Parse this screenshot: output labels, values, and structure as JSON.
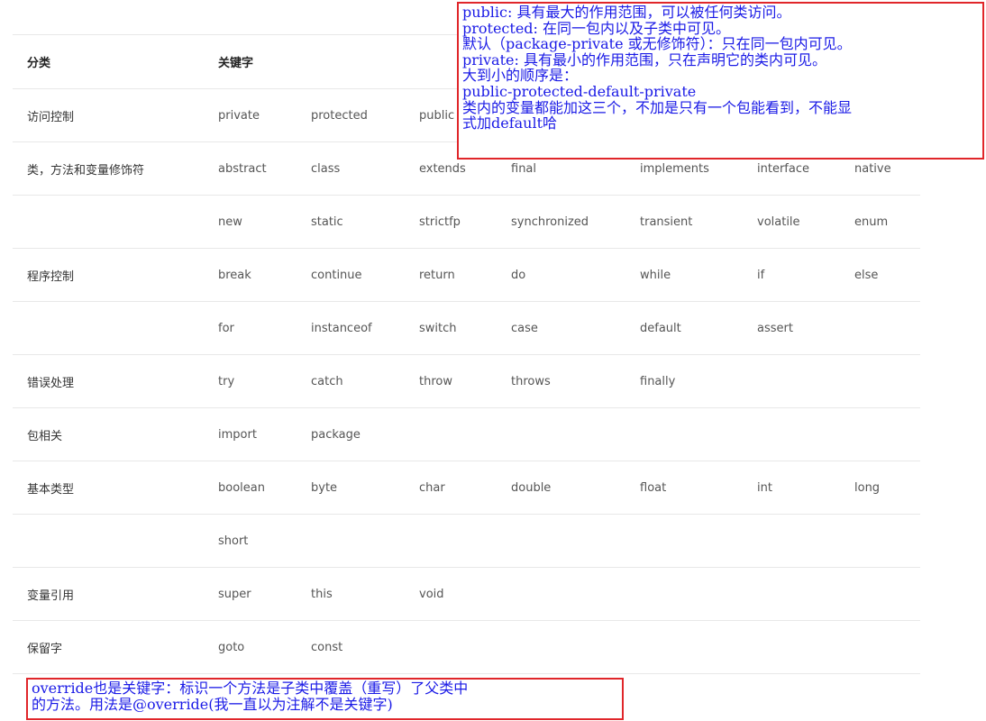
{
  "table": {
    "headers": [
      "分类",
      "关键字",
      "",
      "",
      "",
      "",
      "",
      ""
    ],
    "rows": [
      [
        "访问控制",
        "private",
        "protected",
        "public",
        "",
        "",
        "",
        ""
      ],
      [
        "类，方法和变量修饰符",
        "abstract",
        "class",
        "extends",
        "final",
        "implements",
        "interface",
        "native"
      ],
      [
        "",
        "new",
        "static",
        "strictfp",
        "synchronized",
        "transient",
        "volatile",
        "enum"
      ],
      [
        "程序控制",
        "break",
        "continue",
        "return",
        "do",
        "while",
        "if",
        "else"
      ],
      [
        "",
        "for",
        "instanceof",
        "switch",
        "case",
        "default",
        "assert",
        ""
      ],
      [
        "错误处理",
        "try",
        "catch",
        "throw",
        "throws",
        "finally",
        "",
        ""
      ],
      [
        "包相关",
        "import",
        "package",
        "",
        "",
        "",
        "",
        ""
      ],
      [
        "基本类型",
        "boolean",
        "byte",
        "char",
        "double",
        "float",
        "int",
        "long"
      ],
      [
        "",
        "short",
        "",
        "",
        "",
        "",
        "",
        ""
      ],
      [
        "变量引用",
        "super",
        "this",
        "void",
        "",
        "",
        "",
        ""
      ],
      [
        "保留字",
        "goto",
        "const",
        "",
        "",
        "",
        "",
        ""
      ]
    ]
  },
  "annotations": {
    "top_lines": [
      "public: 具有最大的作用范围，可以被任何类访问。",
      "protected: 在同一包内以及子类中可见。",
      "默认（package-private 或无修饰符）：只在同一包内可见。",
      "private: 具有最小的作用范围，只在声明它的类内可见。",
      "大到小的顺序是：",
      "public-protected-default-private",
      "类内的变量都能加这三个，不加是只有一个包能看到，不能显",
      "式加default哈"
    ],
    "bottom_lines": [
      "override也是关键字：标识一个方法是子类中覆盖（重写）了父类中",
      "的方法。用法是@override(我一直以为注解不是关键字)"
    ],
    "border_color": "#e0262a",
    "text_color": "#1a1ae6"
  }
}
